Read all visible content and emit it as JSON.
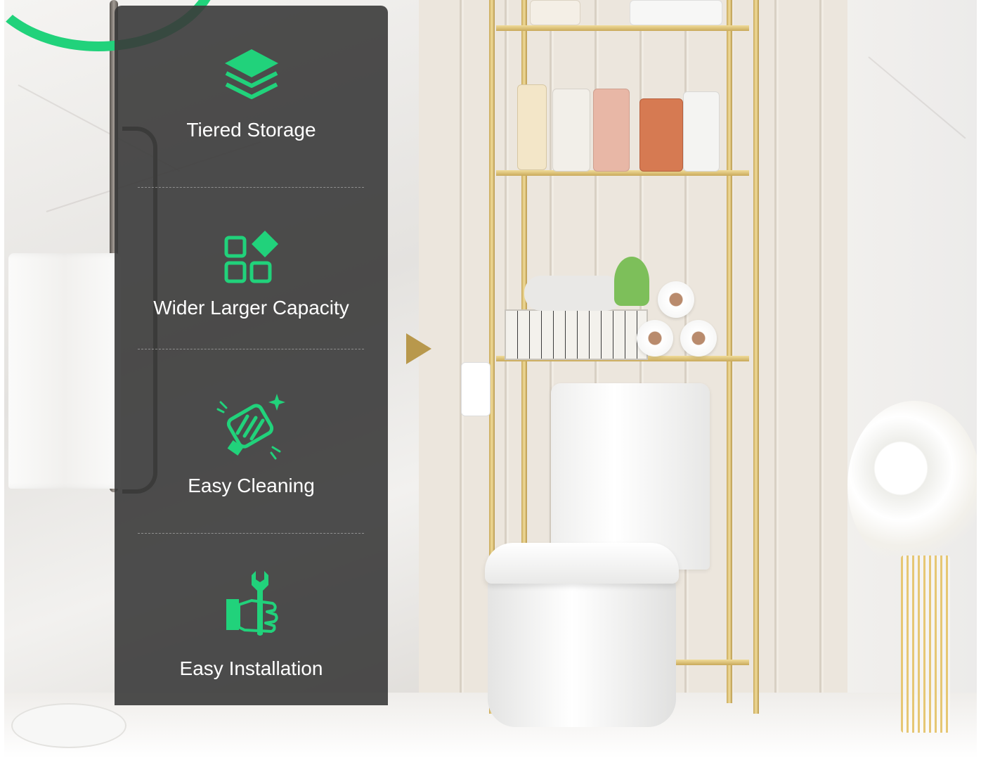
{
  "colors": {
    "accent_green": "#21d27b",
    "panel_background": "#3a3a3a",
    "frame_gold": "#c9a95a",
    "label_text": "#ffffff"
  },
  "features": [
    {
      "label": "Tiered Storage",
      "icon": "stacked-layers-icon"
    },
    {
      "label": "Wider Larger Capacity",
      "icon": "grid-blocks-icon"
    },
    {
      "label": "Easy Cleaning",
      "icon": "hand-wiping-icon"
    },
    {
      "label": "Easy Installation",
      "icon": "wrench-hand-icon"
    }
  ]
}
